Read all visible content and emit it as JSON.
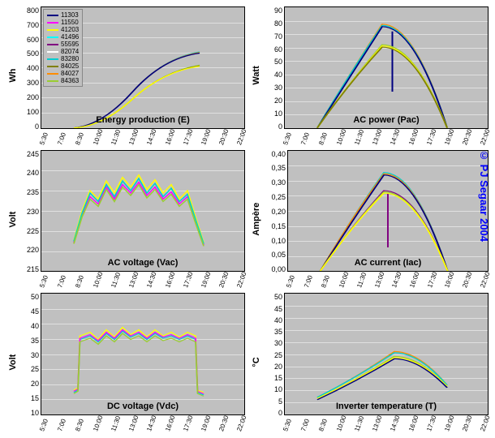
{
  "copyright": "© PJ Segaar 2004",
  "legend": {
    "series": [
      {
        "id": "11303",
        "color": "#000080"
      },
      {
        "id": "11550",
        "color": "#ff00ff"
      },
      {
        "id": "41203",
        "color": "#ffff00"
      },
      {
        "id": "41496",
        "color": "#00ffff"
      },
      {
        "id": "55595",
        "color": "#800080"
      },
      {
        "id": "82074",
        "color": "#ffffff"
      },
      {
        "id": "83280",
        "color": "#00ced1"
      },
      {
        "id": "84025",
        "color": "#808000"
      },
      {
        "id": "84027",
        "color": "#ff8c00"
      },
      {
        "id": "84363",
        "color": "#9acd32"
      }
    ]
  },
  "xaxis": {
    "ticks": [
      "5:30",
      "7:00",
      "8:30",
      "10:00",
      "11:30",
      "13:00",
      "14:30",
      "16:00",
      "17:30",
      "19:00",
      "20:30",
      "22:00"
    ]
  },
  "chart_data": [
    {
      "key": "energy",
      "title": "Energy production (E)",
      "ylabel": "Wh",
      "yticks": [
        "800",
        "700",
        "600",
        "500",
        "400",
        "300",
        "200",
        "100",
        "0"
      ],
      "ylim": [
        0,
        800
      ],
      "type": "line",
      "note": "Cumulative curves rising from ~07:00 to ~19:00; upper cluster reaches ~500 Wh, lower cluster ~410 Wh",
      "series_groups": [
        {
          "final": 500,
          "color_ref": [
            "11303",
            "41496",
            "83280",
            "84027"
          ]
        },
        {
          "final": 410,
          "color_ref": [
            "11550",
            "41203",
            "55595",
            "82074",
            "84025",
            "84363"
          ]
        }
      ]
    },
    {
      "key": "pac",
      "title": "AC power (Pac)",
      "ylabel": "Watt",
      "yticks": [
        "90",
        "80",
        "70",
        "60",
        "50",
        "40",
        "30",
        "20",
        "10",
        "0"
      ],
      "ylim": [
        0,
        90
      ],
      "type": "line",
      "note": "Bell-shaped curves; upper group peaks ~78 W near 13:00, lower group peaks ~62 W; sharp downward spike on one blue series near 14:00",
      "peaks": {
        "upper": 78,
        "lower": 62,
        "at": "13:00"
      }
    },
    {
      "key": "vac",
      "title": "AC voltage (Vac)",
      "ylabel": "Volt",
      "yticks": [
        "245",
        "240",
        "235",
        "230",
        "225",
        "220",
        "215"
      ],
      "ylim": [
        215,
        245
      ],
      "type": "line",
      "note": "Noisy band mostly 225–238 V between 07:00 and 19:00; drops to ~222 V at ends"
    },
    {
      "key": "iac",
      "title": "AC current (Iac)",
      "ylabel": "Ampère",
      "yticks": [
        "0,40",
        "0,35",
        "0,30",
        "0,25",
        "0,20",
        "0,15",
        "0,10",
        "0,05",
        "0,00"
      ],
      "ylim": [
        0.0,
        0.4
      ],
      "type": "line",
      "note": "Bell-shaped; upper group peaks ~0.33 A, lower group ~0.27 A near 13:00; downward spikes near 13:30"
    },
    {
      "key": "vdc",
      "title": "DC voltage (Vdc)",
      "ylabel": "Volt",
      "yticks": [
        "50",
        "45",
        "40",
        "35",
        "30",
        "25",
        "20",
        "15",
        "10"
      ],
      "ylim": [
        10,
        50
      ],
      "type": "line",
      "note": "Rises sharply ~07:30 from ~18 V to plateau ~32–38 V (noisy), drops sharply ~18:30"
    },
    {
      "key": "temp",
      "title": "Inverter temperature (T)",
      "ylabel": "°C",
      "yticks": [
        "50",
        "45",
        "40",
        "35",
        "30",
        "25",
        "20",
        "15",
        "10",
        "5",
        "0"
      ],
      "ylim": [
        0,
        50
      ],
      "type": "line",
      "note": "Gentle hump from ~7 °C at 07:00 to peak ~26 °C near 14:30, back to ~12 °C by 19:00"
    }
  ]
}
